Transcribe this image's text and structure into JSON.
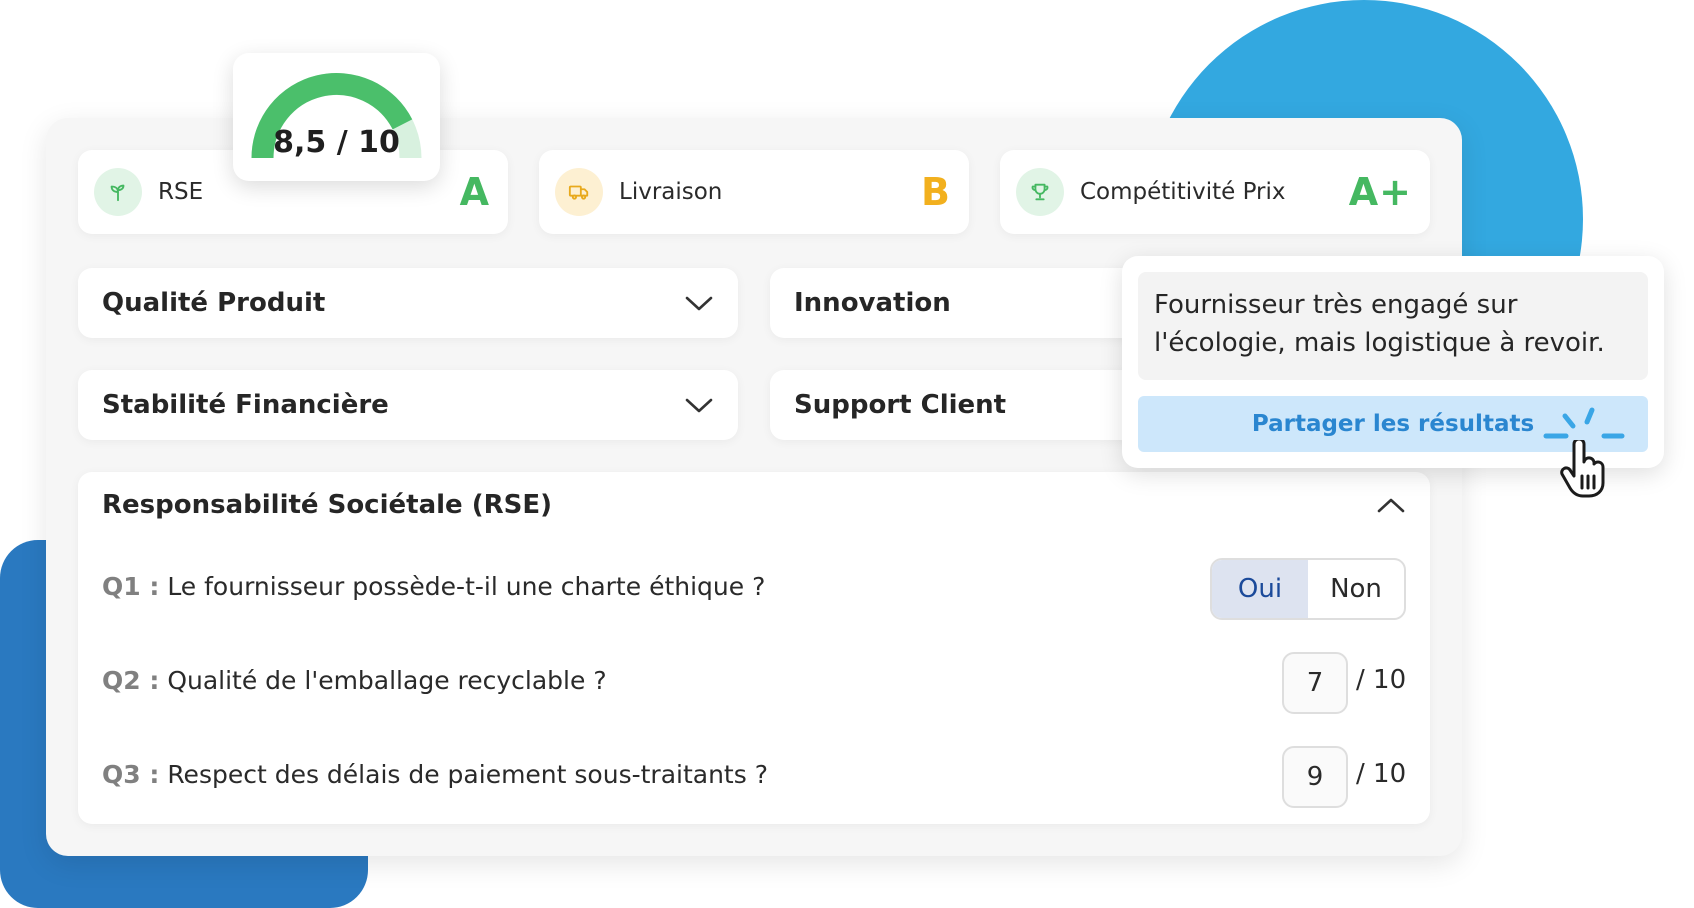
{
  "gauge": {
    "value_text": "8,5 / 10",
    "score": 8.5,
    "max": 10,
    "color": "#4bbf6b",
    "track_color": "#d8f1df"
  },
  "score_cards": [
    {
      "label": "RSE",
      "grade": "A",
      "icon": "sprout-icon",
      "grade_color": "#45b861",
      "icon_bg": "#e1f4e6",
      "icon_color": "#45b861"
    },
    {
      "label": "Livraison",
      "grade": "B",
      "icon": "truck-icon",
      "grade_color": "#f2b01e",
      "icon_bg": "#fdf0d2",
      "icon_color": "#e8a91c"
    },
    {
      "label": "Compétitivité Prix",
      "grade": "A+",
      "icon": "trophy-icon",
      "grade_color": "#45b861",
      "icon_bg": "#e1f4e6",
      "icon_color": "#45b861"
    }
  ],
  "sections": [
    {
      "title": "Qualité Produit",
      "icon": "chevron-down-icon"
    },
    {
      "title": "Innovation",
      "icon": "chevron-down-icon"
    },
    {
      "title": "Stabilité Financière",
      "icon": "chevron-down-icon"
    },
    {
      "title": "Support Client",
      "icon": "chevron-down-icon"
    }
  ],
  "rse_section": {
    "title": "Responsabilité Sociétale (RSE)",
    "icon": "chevron-up-icon",
    "questions": [
      {
        "num": "Q1 :",
        "text": "Le fournisseur possède-t-il une charte éthique ?",
        "type": "yes-no",
        "options": [
          "Oui",
          "Non"
        ],
        "selected": "Oui"
      },
      {
        "num": "Q2 :",
        "text": "Qualité de l'emballage recyclable ?",
        "type": "score",
        "value": "7",
        "max": "/ 10"
      },
      {
        "num": "Q3 :",
        "text": "Respect des délais de paiement sous-traitants ?",
        "type": "score",
        "value": "9",
        "max": "/ 10"
      }
    ]
  },
  "share_popup": {
    "comment": "Fournisseur très engagé sur l'écologie, mais logistique à revoir.",
    "button_label": "Partager les résultats",
    "button_color": "#cde7fb",
    "label_color": "#2a86d0"
  },
  "colors": {
    "blue_circle": "#33a8e0",
    "dark_blue": "#2a79c0"
  }
}
